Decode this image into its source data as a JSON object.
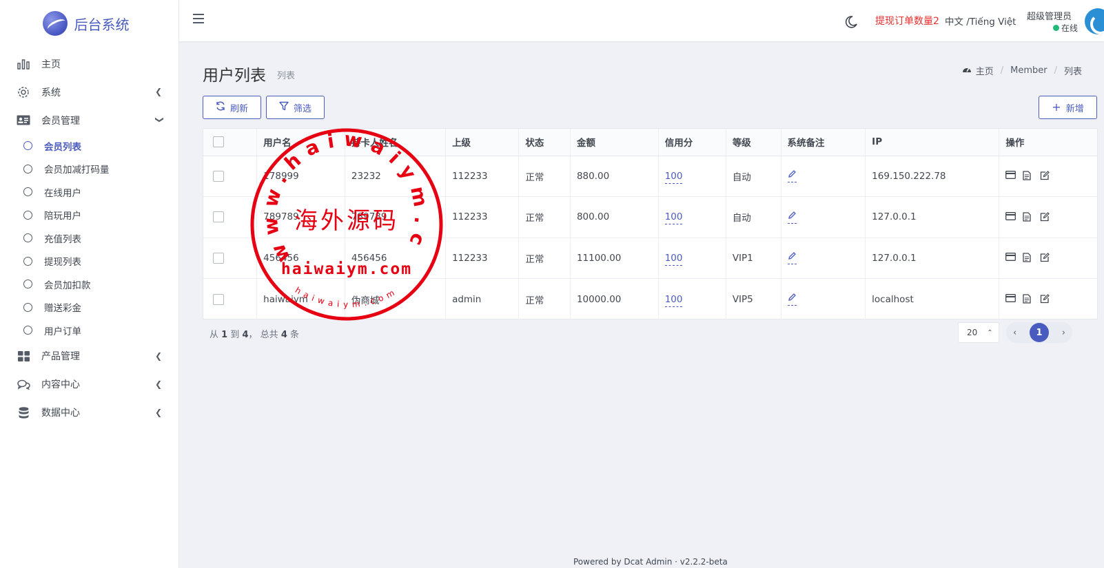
{
  "brand": {
    "name": "后台系统"
  },
  "sidebar": {
    "items": [
      {
        "label": "主页",
        "icon": "bar-chart-icon"
      },
      {
        "label": "系统",
        "icon": "gear-icon"
      },
      {
        "label": "会员管理",
        "icon": "id-card-icon"
      },
      {
        "label": "产品管理",
        "icon": "grid-icon"
      },
      {
        "label": "内容中心",
        "icon": "chat-icon"
      },
      {
        "label": "数据中心",
        "icon": "database-icon"
      }
    ],
    "member_sub": [
      {
        "label": "会员列表"
      },
      {
        "label": "会员加减打码量"
      },
      {
        "label": "在线用户"
      },
      {
        "label": "陪玩用户"
      },
      {
        "label": "充值列表"
      },
      {
        "label": "提现列表"
      },
      {
        "label": "会员加扣款"
      },
      {
        "label": "赠送彩金"
      },
      {
        "label": "用户订单"
      }
    ]
  },
  "header": {
    "alert": "提现订单数量2",
    "lang": "中文 /Tiếng Việt",
    "user_role": "超级管理员",
    "user_status": "在线"
  },
  "page": {
    "title": "用户列表",
    "subtitle": "列表",
    "breadcrumb": [
      "主页",
      "Member",
      "列表"
    ]
  },
  "toolbar": {
    "refresh": "刷新",
    "filter": "筛选",
    "new": "新增"
  },
  "table": {
    "headers": [
      "用户名",
      "持卡人姓名",
      "上级",
      "状态",
      "金额",
      "信用分",
      "等级",
      "系统备注",
      "IP",
      "操作"
    ],
    "rows": [
      [
        "178999",
        "23232",
        "112233",
        "正常",
        "880.00",
        "100",
        "自动",
        "169.150.222.78"
      ],
      [
        "789789",
        "789789",
        "112233",
        "正常",
        "800.00",
        "100",
        "自动",
        "127.0.0.1"
      ],
      [
        "456456",
        "456456",
        "112233",
        "正常",
        "11100.00",
        "100",
        "VIP1",
        "127.0.0.1"
      ],
      [
        "haiwaiym",
        "伪商城",
        "admin",
        "正常",
        "10000.00",
        "100",
        "VIP5",
        "localhost"
      ]
    ]
  },
  "pagination": {
    "summary_prefix": "从",
    "from": "1",
    "to_word": "到",
    "to": "4",
    "total_word": "， 总共",
    "total": "4",
    "unit": "条",
    "per_page": "20",
    "current": "1"
  },
  "footer": {
    "powered": "Powered by Dcat Admin · v2.2.2-beta"
  },
  "watermark": {
    "outer_text": "www.haiwaiym.com",
    "center_text": "海外源码",
    "line_text": "haiwaiym.com",
    "inner_text": "haiwaiym.com"
  },
  "colors": {
    "primary": "#4a5bbf",
    "alert": "#e52e2e",
    "online": "#21b978",
    "stamp": "#e60012"
  }
}
